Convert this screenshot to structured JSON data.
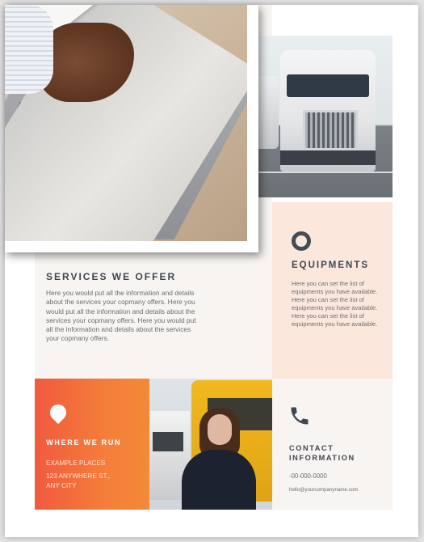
{
  "services": {
    "title": "SERVICES WE OFFER",
    "body": "Here you would put all the information and details about the services your copmany offers. Here you would put all the information and details about the services your copmany offers. Here you would put all the information and details about the services your copmany offers."
  },
  "equipments": {
    "title": "EQUIPMENTS",
    "body": "Here you can set the list of equipments you have available. Here you can set the list of equipments you have available. Here you can set the list of equipments you have available."
  },
  "where": {
    "title": "WHERE WE RUN",
    "places": "EXAMPLE PLACES",
    "address_line1": "123 ANYWHERE ST.,",
    "address_line2": "ANY CITY"
  },
  "contact": {
    "title_line1": "CONTACT",
    "title_line2": "INFORMATION",
    "phone": "-00-000-0000",
    "email": "hello@yourcompanyname.com"
  },
  "colors": {
    "accent_orange": "#f15a3e",
    "peach_panel": "#fbe7dc",
    "heading": "#3e4752"
  },
  "icons": [
    "ring-icon",
    "location-pin-icon",
    "phone-icon"
  ]
}
